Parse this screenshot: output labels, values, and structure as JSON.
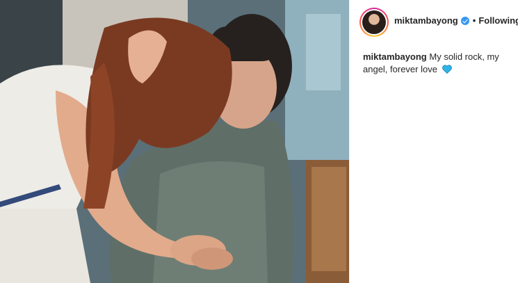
{
  "post": {
    "username": "miktambayong",
    "separator": "•",
    "follow_label": "Following",
    "verified_icon": "verified-badge-icon",
    "caption_text": "My solid rock, my angel, forever love",
    "caption_emoji": "blue-heart-icon"
  },
  "colors": {
    "verified": "#3897f0",
    "heart": "#2fb4e8",
    "text": "#262626"
  }
}
